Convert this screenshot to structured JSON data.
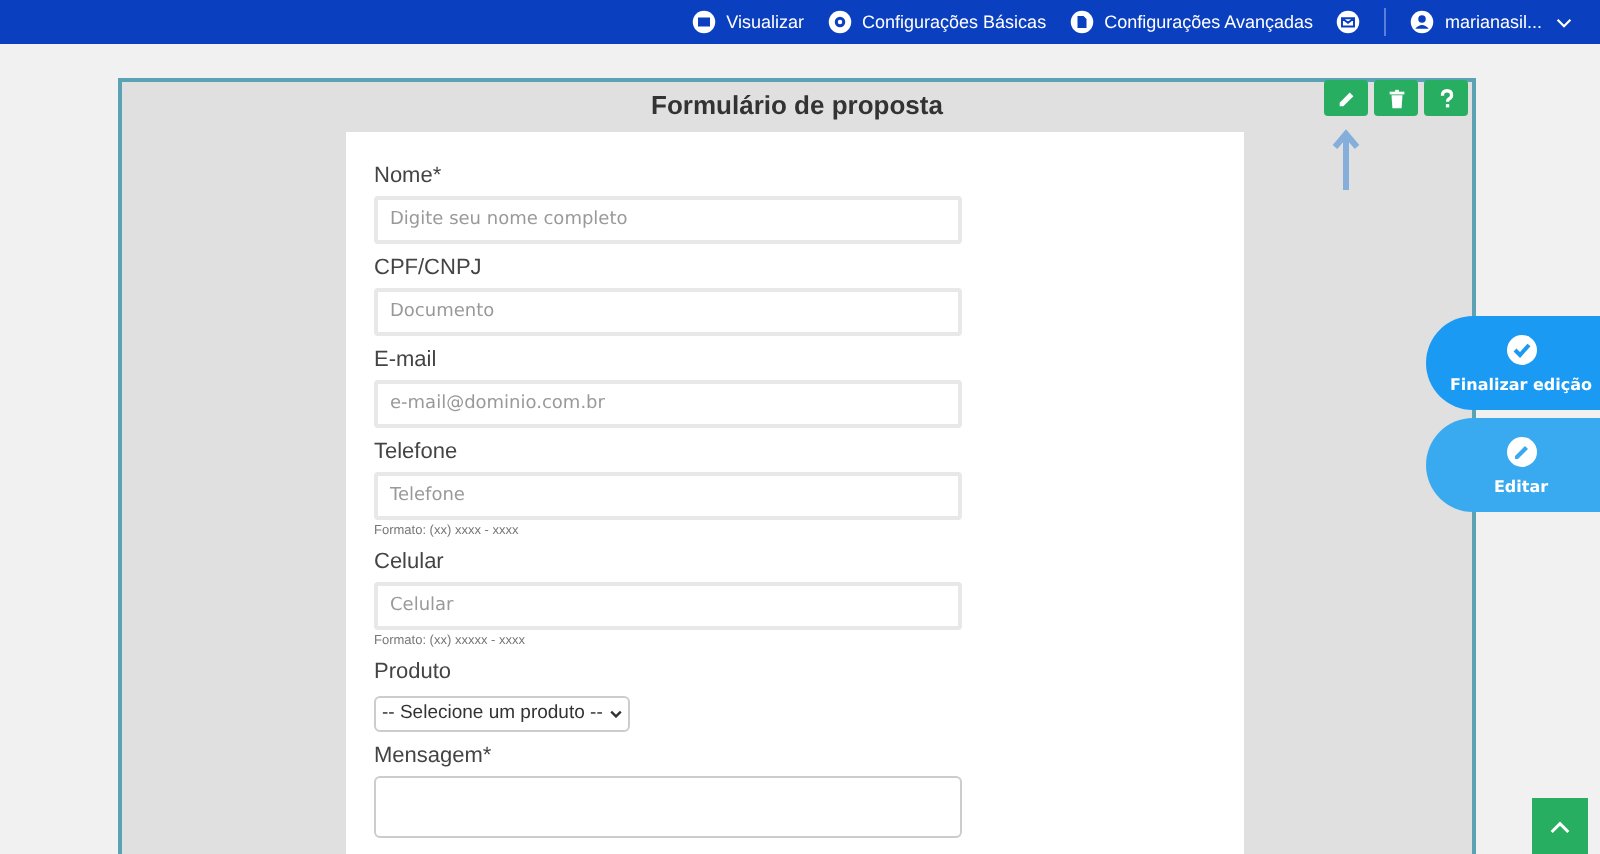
{
  "topbar": {
    "links": [
      {
        "kind": "visualize",
        "label": "Visualizar"
      },
      {
        "kind": "gear",
        "label": "Configurações Básicas"
      },
      {
        "kind": "doc",
        "label": "Configurações Avançadas"
      }
    ],
    "user": "marianasil..."
  },
  "form": {
    "title": "Formulário de proposta",
    "fields": [
      {
        "kind": "text",
        "label": "Nome*",
        "placeholder": "Digite seu nome completo"
      },
      {
        "kind": "text",
        "label": "CPF/CNPJ",
        "placeholder": "Documento"
      },
      {
        "kind": "text",
        "label": "E-mail",
        "placeholder": "e-mail@dominio.com.br"
      },
      {
        "kind": "text",
        "label": "Telefone",
        "placeholder": "Telefone",
        "hint": "Formato: (xx) xxxx - xxxx"
      },
      {
        "kind": "text",
        "label": "Celular",
        "placeholder": "Celular",
        "hint": "Formato: (xx) xxxxx - xxxx"
      },
      {
        "kind": "select",
        "label": "Produto",
        "value": "-- Selecione um produto --"
      },
      {
        "kind": "textarea",
        "label": "Mensagem*"
      }
    ]
  },
  "side_buttons": [
    {
      "kind": "check",
      "label": "Finalizar edição"
    },
    {
      "kind": "pencil",
      "label": "Editar"
    }
  ]
}
